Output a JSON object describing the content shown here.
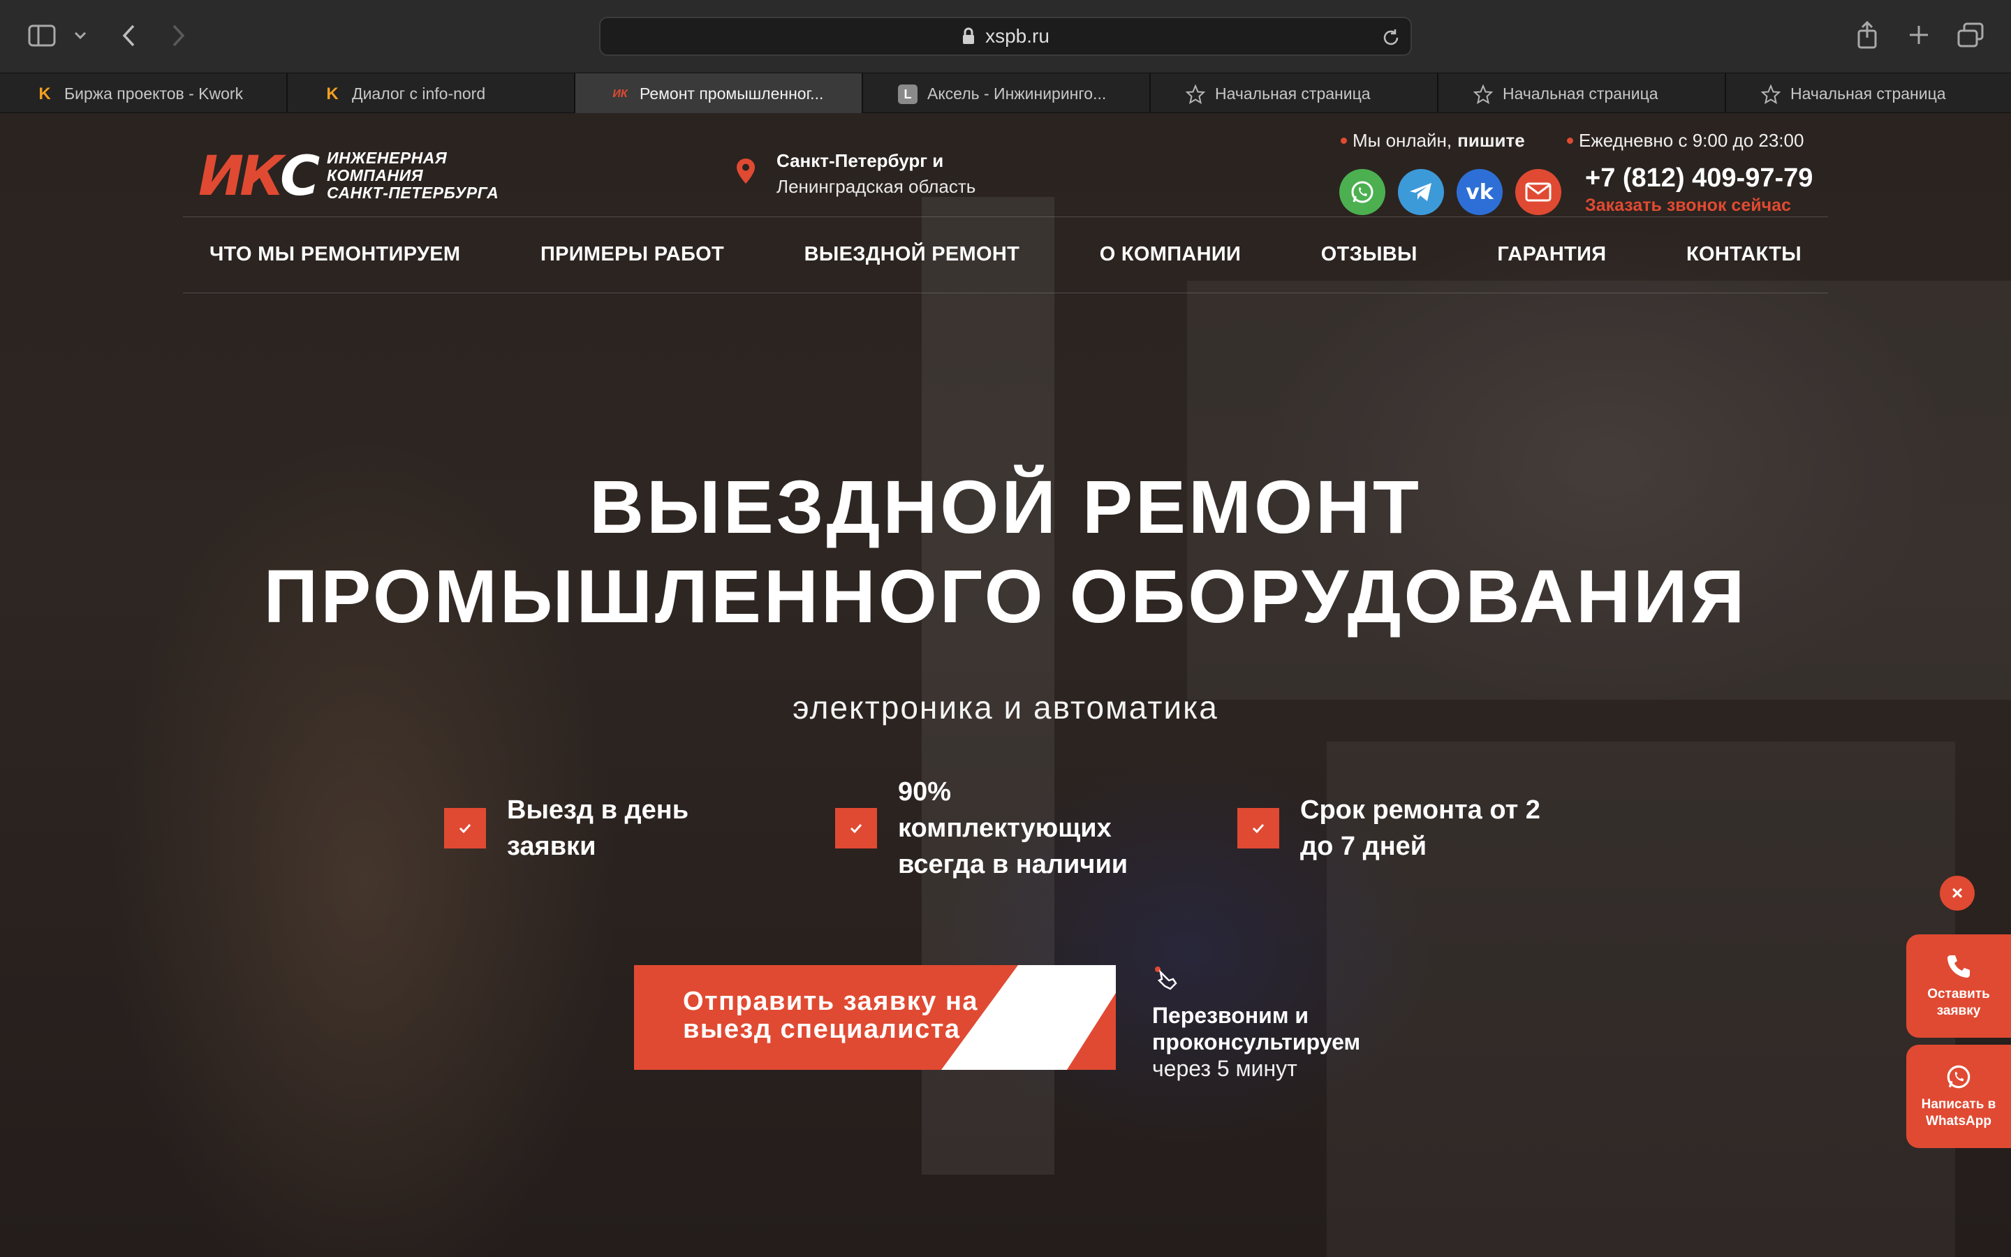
{
  "browser": {
    "url": "xspb.ru",
    "tabs": [
      {
        "label": "Биржа проектов - Kwork",
        "favicon": "kwork-logo-icon"
      },
      {
        "label": "Диалог с info-nord",
        "favicon": "kwork-logo-icon"
      },
      {
        "label": "Ремонт промышленног...",
        "favicon": "iks-logo-icon",
        "active": true
      },
      {
        "label": "Аксель - Инжиниринго...",
        "favicon": "letter-l-icon",
        "letter": "L"
      },
      {
        "label": "Начальная страница",
        "favicon": "star-icon"
      },
      {
        "label": "Начальная страница",
        "favicon": "star-icon"
      },
      {
        "label": "Начальная страница",
        "favicon": "star-icon"
      }
    ]
  },
  "header": {
    "logo": {
      "mark": "ИКС",
      "lines": [
        "Инженерная",
        "компания",
        "Санкт-Петербурга"
      ]
    },
    "location": {
      "line1": "Санкт-Петербург и",
      "line2": "Ленинградская область"
    },
    "online_text": "Мы онлайн,",
    "online_bold": "пишите",
    "hours": "Ежедневно с 9:00 до 23:00",
    "phone": "+7 (812) 409-97-79",
    "callback": "Заказать звонок сейчас",
    "socials": [
      {
        "name": "whatsapp-icon",
        "color": "#4cb050"
      },
      {
        "name": "telegram-icon",
        "color": "#3d9ad9"
      },
      {
        "name": "vk-icon",
        "color": "#2d6fd6"
      },
      {
        "name": "email-icon",
        "color": "#e04a32"
      }
    ]
  },
  "nav": [
    "Что мы ремонтируем",
    "Примеры работ",
    "Выездной ремонт",
    "О компании",
    "Отзывы",
    "Гарантия",
    "Контакты"
  ],
  "hero": {
    "title_line1": "Выездной ремонт",
    "title_line2": "промышленного оборудования",
    "subtitle": "электроника и автоматика",
    "features": [
      {
        "line1": "Выезд в день",
        "line2": "заявки"
      },
      {
        "line1": "90%",
        "line2": "комплектующих",
        "line3": "всегда в наличии"
      },
      {
        "line1": "Срок ремонта от 2",
        "line2": "до 7 дней"
      }
    ],
    "cta_label": "Отправить заявку на выезд специалиста",
    "cta_note_bold": "Перезвоним и проконсультируем",
    "cta_note": "через 5 минут"
  },
  "widget": {
    "close": "×",
    "request_label": "Оставить заявку",
    "whatsapp_label": "Написать в WhatsApp"
  },
  "colors": {
    "accent": "#e04a32",
    "chrome": "#2b2b2b"
  }
}
